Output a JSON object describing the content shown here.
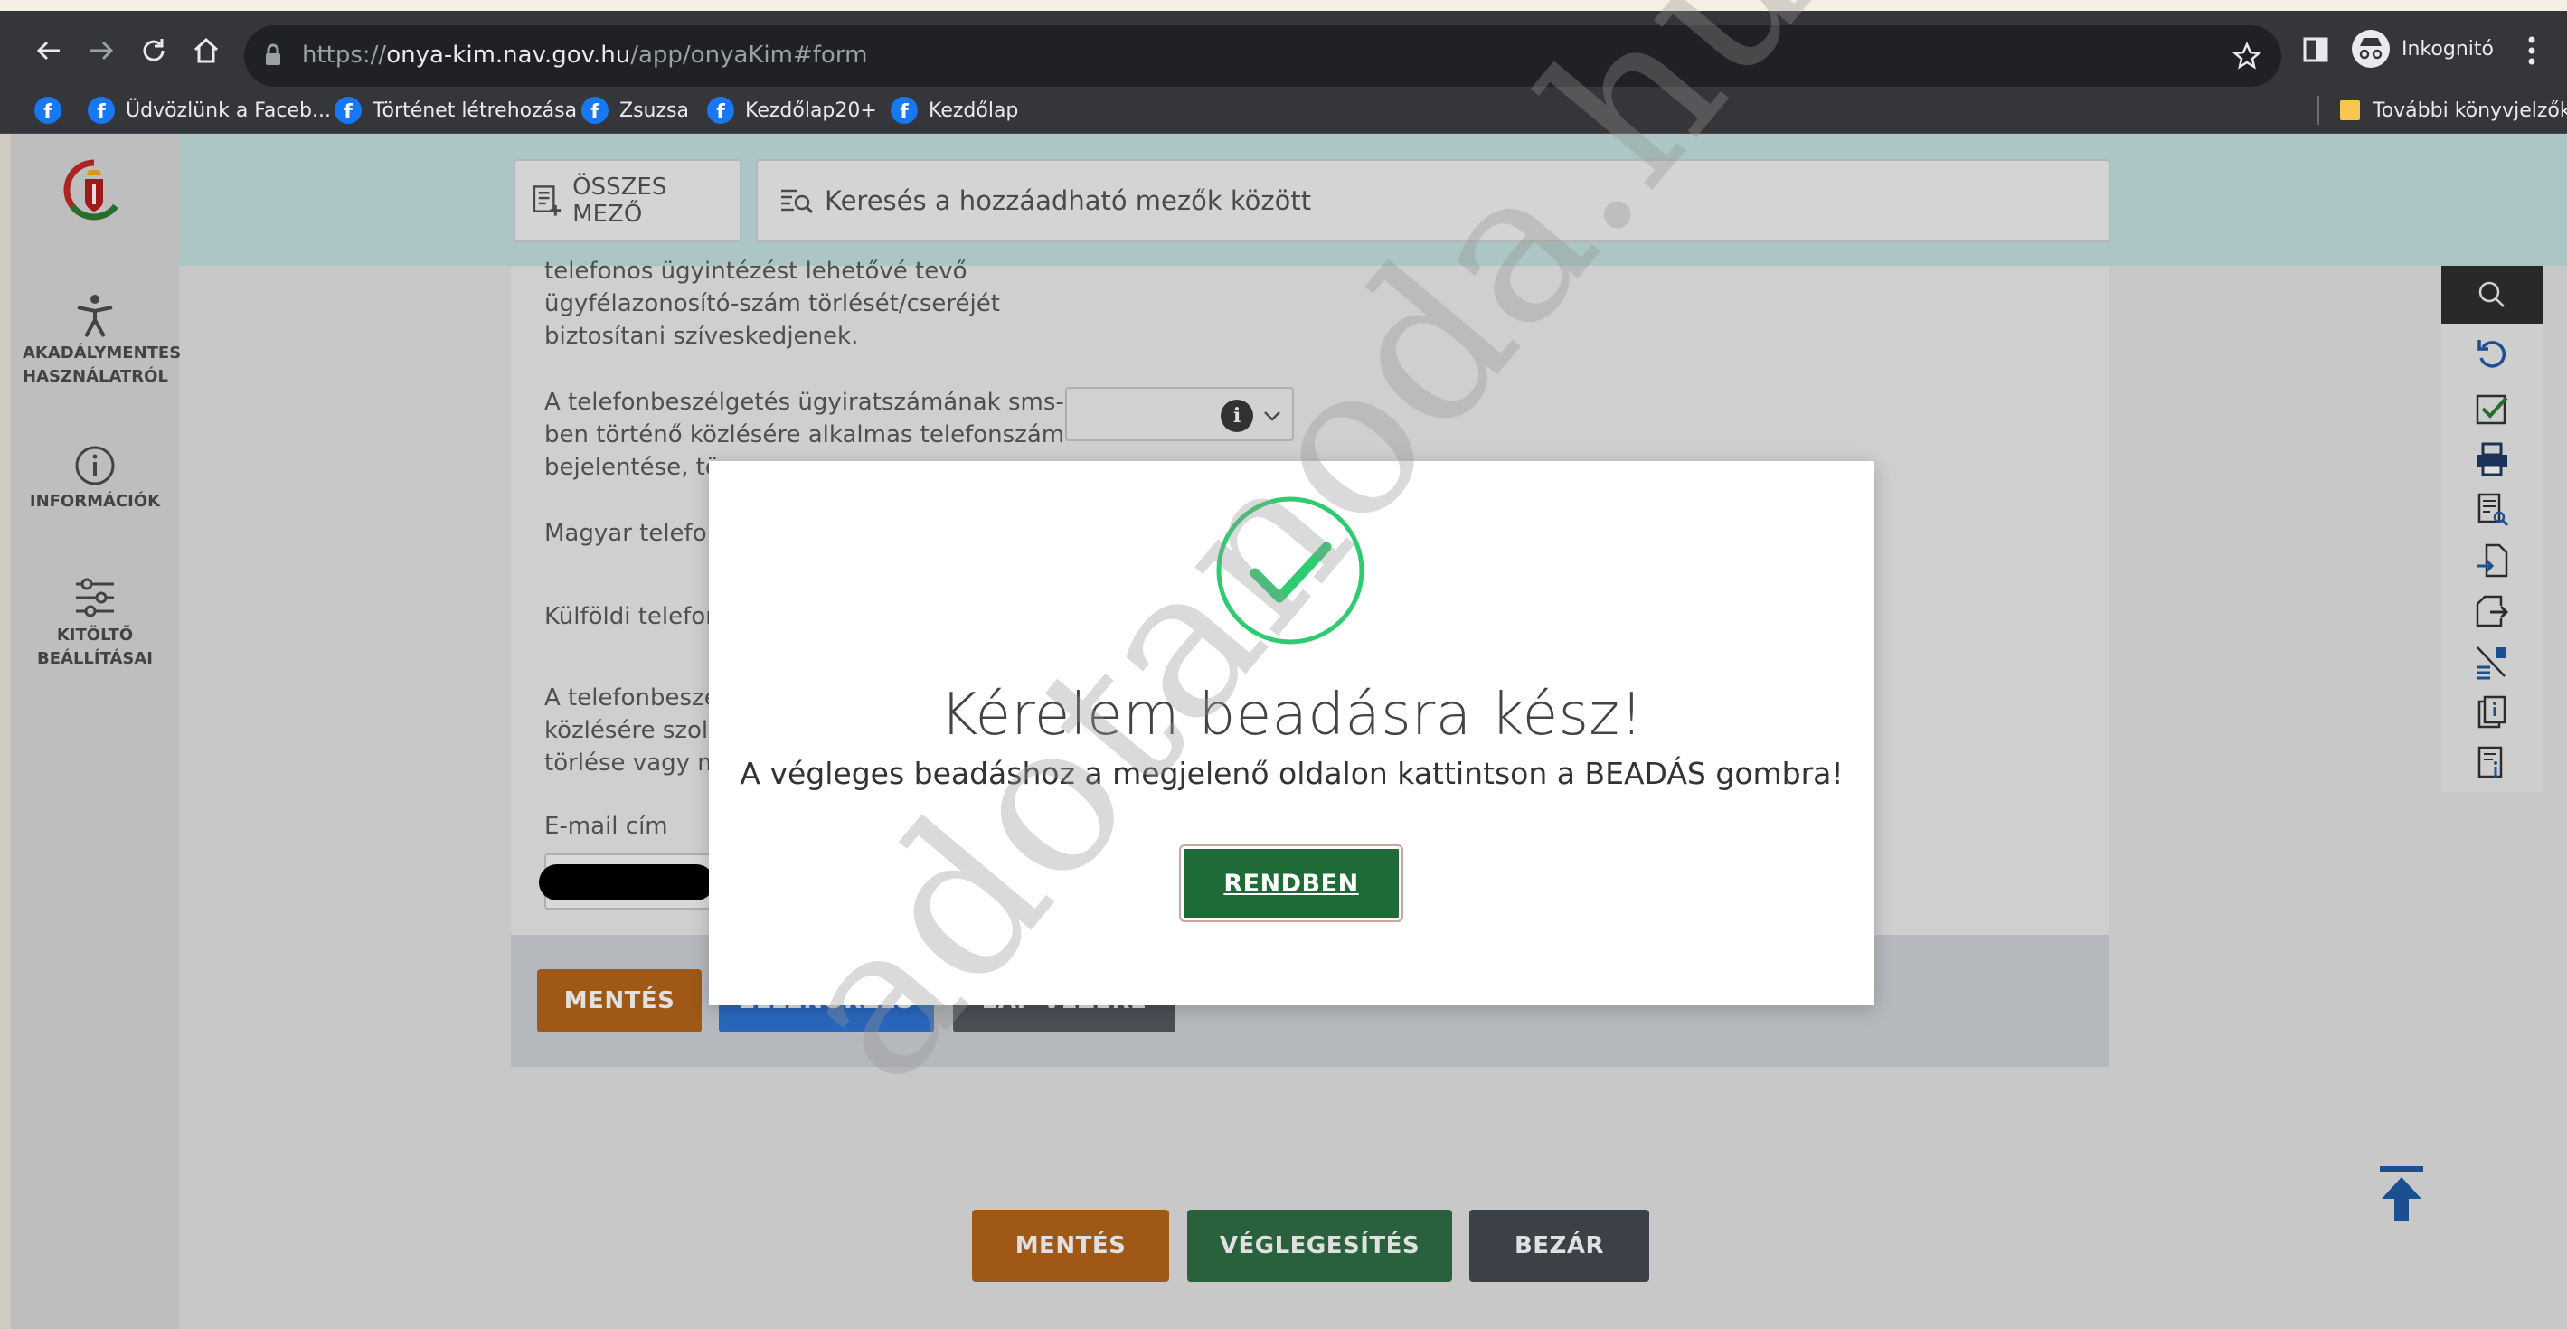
{
  "browser": {
    "url_scheme": "https://",
    "url_host": "onya-kim.nav.gov.hu",
    "url_path": "/app/onyaKim#form",
    "profile_label": "Inkognitó",
    "bookmarks": [
      {
        "label": "Üdvözlünk a Faceb...",
        "icon": "facebook-icon"
      },
      {
        "label": "Történet létrehozása",
        "icon": "facebook-icon"
      },
      {
        "label": "Zsuzsa",
        "icon": "facebook-icon"
      },
      {
        "label": "Kezdőlap20+",
        "icon": "facebook-icon"
      },
      {
        "label": "Kezdőlap",
        "icon": "facebook-icon"
      }
    ],
    "other_bookmarks": "További könyvjelzők"
  },
  "sidebar": {
    "items": [
      {
        "label": "AKADÁLYMENTES HASZNÁLATRÓL",
        "icon": "accessibility-icon"
      },
      {
        "label": "INFORMÁCIÓK",
        "icon": "info-icon"
      },
      {
        "label": "KITÖLTŐ BEÁLLÍTÁSAI",
        "icon": "sliders-icon"
      }
    ]
  },
  "header": {
    "all_fields_label": "ÖSSZES MEZŐ",
    "search_placeholder": "Keresés a hozzáadható mezők között"
  },
  "form": {
    "text1_line1": "telefonos ügyintézést lehetővé tevő",
    "text1_line2": "ügyfélazonosító-szám törlését/cseréjét",
    "text1_line3": "biztosítani szíveskedjenek.",
    "text2_line1": "A telefonbeszélgetés ügyiratszámának sms-",
    "text2_line2": "ben történő közlésére alkalmas telefonszám",
    "text2_line3": "bejelentése, tö",
    "magyar": "Magyar telefon",
    "kulfoldi": "Külföldi telefon",
    "text3_line1": "A telefonbeszél",
    "text3_line2": "közlésére szolg",
    "text3_line3": "törlése vagy mó",
    "email_label": "E-mail cím",
    "inner_buttons": {
      "save": "MENTÉS",
      "check": "ELLENŐRZÉS",
      "eap": "EAP-VEZÉRE"
    }
  },
  "bottom_buttons": {
    "save": "MENTÉS",
    "finalize": "VÉGLEGESÍTÉS",
    "close": "BEZÁR"
  },
  "modal": {
    "title": "Kérelem beadásra kész!",
    "message": "A végleges beadáshoz a megjelenő oldalon kattintson a BEADÁS gombra!",
    "ok_label": "RENDBEN"
  },
  "watermark": "adotanoda.hu",
  "colors": {
    "teal_header": "#c3e2e0",
    "success_green": "#2ecc71",
    "ok_button": "#1e6b37"
  }
}
